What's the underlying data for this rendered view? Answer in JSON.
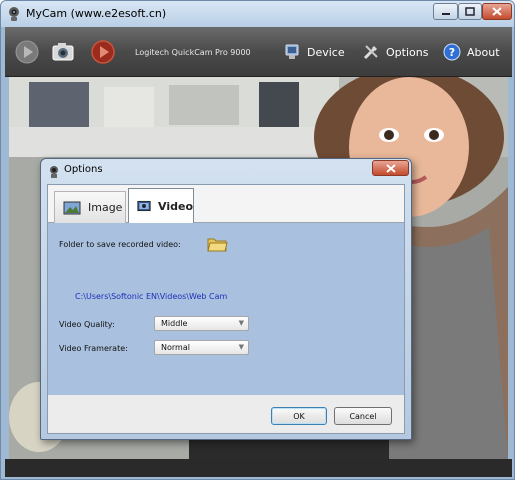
{
  "window": {
    "title": "MyCam (www.e2esoft.cn)"
  },
  "toolbar": {
    "camera_name": "Logitech QuickCam Pro 9000",
    "device_label": "Device",
    "options_label": "Options",
    "about_label": "About"
  },
  "dialog": {
    "title": "Options",
    "tabs": [
      {
        "label": "Image",
        "selected": false
      },
      {
        "label": "Video",
        "selected": true
      }
    ],
    "folder_label": "Folder to save recorded video:",
    "folder_path": "C:\\Users\\Softonic EN\\Videos\\Web Cam",
    "quality_label": "Video Quality:",
    "quality_value": "Middle",
    "framerate_label": "Video Framerate:",
    "framerate_value": "Normal",
    "ok_label": "OK",
    "cancel_label": "Cancel"
  },
  "colors": {
    "toolbar_bg": "#4a4a4a",
    "panel_bg": "#a9c1de",
    "path_text": "#1f2fb8",
    "close_button": "#c44a2c"
  }
}
